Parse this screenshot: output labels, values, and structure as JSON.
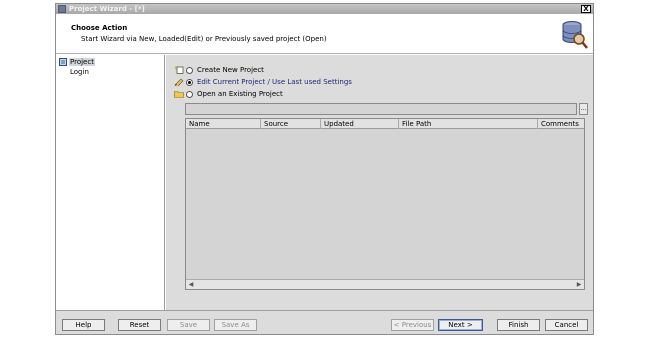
{
  "window": {
    "title": "Project Wizard - [*]",
    "close_label": "X"
  },
  "header": {
    "title": "Choose Action",
    "subtitle": "Start Wizard via New, Loaded(Edit) or Previously saved project (Open)"
  },
  "nav": {
    "items": [
      {
        "label": "Project",
        "selected": true,
        "icon": "project-icon"
      },
      {
        "label": "Login",
        "selected": false,
        "icon": ""
      }
    ]
  },
  "actions": {
    "options": [
      {
        "label": "Create New Project",
        "checked": false,
        "icon": "new-project-icon"
      },
      {
        "label": "Edit Current Project / Use Last used Settings",
        "checked": true,
        "icon": "edit-icon"
      },
      {
        "label": "Open an Existing Project",
        "checked": false,
        "icon": "folder-icon"
      }
    ]
  },
  "path": {
    "value": "",
    "browse_label": "..."
  },
  "table": {
    "columns": [
      "Name",
      "Source",
      "Updated",
      "File Path",
      "Comments"
    ],
    "rows": []
  },
  "footer": {
    "help": "Help",
    "reset": "Reset",
    "save": "Save",
    "save_as": "Save As",
    "previous": "< Previous",
    "next": "Next >",
    "finish": "Finish",
    "cancel": "Cancel"
  }
}
